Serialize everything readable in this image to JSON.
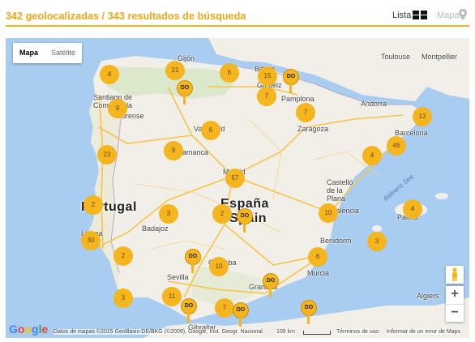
{
  "header": {
    "title": "342 geolocalizadas / 343 resultados de búsqueda",
    "view_list_label": "Lista",
    "view_map_label": "Mapa"
  },
  "map": {
    "maptype_map": "Mapa",
    "maptype_satellite": "Satélite",
    "zoom_in": "+",
    "zoom_out": "−",
    "logo": "Google",
    "attribution": "Datos de mapas ©2015 GeoBasis-DE/BKG (©2009), Google, Inst. Geogr. Nacional",
    "scale_label": "100 km",
    "terms": "Términos de uso",
    "report": "Informar de un error de Maps",
    "labels": {
      "country_es_1": "España",
      "country_es_2": "Spain",
      "portugal": "Portugal",
      "andorra": "Andorra",
      "toulouse": "Toulouse",
      "montpellier": "Montpellier",
      "gijon": "Gijón",
      "bilbao": "Bilbao",
      "gasteiz": "Gasteiz",
      "pamplona": "Pamplona",
      "santiago": "Santiago de Compostela",
      "ourense": "Ourense",
      "valladolid": "Valladolid",
      "salamanca": "Salamanca",
      "zaragoza": "Zaragoza",
      "barcelona": "Barcelona",
      "madrid": "Madrid",
      "castello": "Castelló de la Plana",
      "valencia": "València",
      "palma": "Palma",
      "badajoz": "Badajoz",
      "lisbon": "Lisboa",
      "cordoba": "Córdoba",
      "sevilla": "Sevilla",
      "granada": "Granada",
      "murcia": "Murcia",
      "benidorm": "Benidorm",
      "gibraltar": "Gibraltar",
      "algiers": "Algiers",
      "balearic": "Balearic Sea"
    },
    "clusters": [
      "4",
      "21",
      "6",
      "15",
      "9",
      "7",
      "7",
      "6",
      "13",
      "23",
      "9",
      "4",
      "46",
      "57",
      "2",
      "2",
      "3",
      "10",
      "4",
      "30",
      "2",
      "3",
      "6",
      "10",
      "11",
      "3",
      "7"
    ],
    "markers": [
      "DO",
      "DO",
      "DO",
      "DO",
      "DO",
      "DO",
      "DO",
      "DO"
    ],
    "colors": {
      "accent": "#f2a511",
      "cluster": "#f5b51f",
      "water": "#a9cdf0",
      "land": "#f1efe8"
    }
  }
}
